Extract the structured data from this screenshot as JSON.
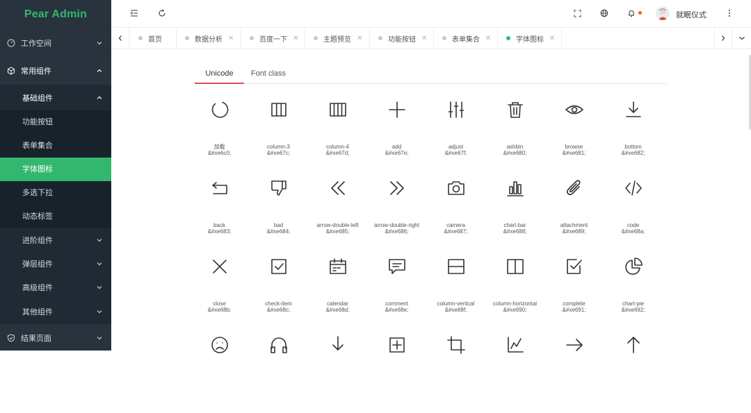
{
  "app": {
    "logo": "Pear Admin"
  },
  "sidebar": {
    "workspace": "工作空间",
    "common": "常用组件",
    "basic": "基础组件",
    "leaves": [
      {
        "label": "功能按钮",
        "active": false
      },
      {
        "label": "表单集合",
        "active": false
      },
      {
        "label": "字体图标",
        "active": true
      },
      {
        "label": "多选下拉",
        "active": false
      },
      {
        "label": "动态标签",
        "active": false
      }
    ],
    "advanced": "进阶组件",
    "popup": "弹层组件",
    "senior": "高级组件",
    "other": "其他组件",
    "result": "结果页面"
  },
  "header": {
    "username": "就眠仪式"
  },
  "tabs": [
    {
      "label": "首页",
      "closable": false,
      "active": false
    },
    {
      "label": "数据分析",
      "closable": true,
      "active": false
    },
    {
      "label": "百度一下",
      "closable": true,
      "active": false
    },
    {
      "label": "主题预览",
      "closable": true,
      "active": false
    },
    {
      "label": "功能按钮",
      "closable": true,
      "active": false
    },
    {
      "label": "表单集合",
      "closable": true,
      "active": false
    },
    {
      "label": "字体图标",
      "closable": true,
      "active": true
    }
  ],
  "page_tabs": {
    "unicode": "Unicode",
    "fontclass": "Font class"
  },
  "icons": [
    {
      "name": "加载",
      "code": "&#xe6c0;",
      "icon": "loading-icon"
    },
    {
      "name": "column-3",
      "code": "&#xe67c;",
      "icon": "column-3-icon"
    },
    {
      "name": "column-4",
      "code": "&#xe67d;",
      "icon": "column-4-icon"
    },
    {
      "name": "add",
      "code": "&#xe67e;",
      "icon": "add-icon"
    },
    {
      "name": "adjust",
      "code": "&#xe67f;",
      "icon": "adjust-icon"
    },
    {
      "name": "ashbin",
      "code": "&#xe680;",
      "icon": "ashbin-icon"
    },
    {
      "name": "browse",
      "code": "&#xe681;",
      "icon": "browse-icon"
    },
    {
      "name": "bottom",
      "code": "&#xe682;",
      "icon": "bottom-icon"
    },
    {
      "name": "back",
      "code": "&#xe683;",
      "icon": "back-icon"
    },
    {
      "name": "bad",
      "code": "&#xe684;",
      "icon": "bad-icon"
    },
    {
      "name": "arrow-double-left",
      "code": "&#xe685;",
      "icon": "arrow-double-left-icon"
    },
    {
      "name": "arrow-double-right",
      "code": "&#xe686;",
      "icon": "arrow-double-right-icon"
    },
    {
      "name": "camera",
      "code": "&#xe687;",
      "icon": "camera-icon"
    },
    {
      "name": "chart-bar",
      "code": "&#xe688;",
      "icon": "chart-bar-icon"
    },
    {
      "name": "attachment",
      "code": "&#xe689;",
      "icon": "attachment-icon"
    },
    {
      "name": "code",
      "code": "&#xe68a;",
      "icon": "code-icon"
    },
    {
      "name": "close",
      "code": "&#xe68b;",
      "icon": "close-icon"
    },
    {
      "name": "check-item",
      "code": "&#xe68c;",
      "icon": "check-item-icon"
    },
    {
      "name": "calendar",
      "code": "&#xe68d;",
      "icon": "calendar-icon"
    },
    {
      "name": "comment",
      "code": "&#xe68e;",
      "icon": "comment-icon"
    },
    {
      "name": "column-vertical",
      "code": "&#xe68f;",
      "icon": "column-vertical-icon"
    },
    {
      "name": "column-horizontal",
      "code": "&#xe690;",
      "icon": "column-horizontal-icon"
    },
    {
      "name": "complete",
      "code": "&#xe691;",
      "icon": "complete-icon"
    },
    {
      "name": "chart-pie",
      "code": "&#xe692;",
      "icon": "chart-pie-icon"
    },
    {
      "name": "",
      "code": "",
      "icon": "sad-face-icon"
    },
    {
      "name": "",
      "code": "",
      "icon": "headphones-icon"
    },
    {
      "name": "",
      "code": "",
      "icon": "download-icon"
    },
    {
      "name": "",
      "code": "",
      "icon": "add-image-icon"
    },
    {
      "name": "",
      "code": "",
      "icon": "crop-icon"
    },
    {
      "name": "",
      "code": "",
      "icon": "chart-line-icon"
    },
    {
      "name": "",
      "code": "",
      "icon": "arrow-right-icon"
    },
    {
      "name": "",
      "code": "",
      "icon": "arrow-up-icon"
    }
  ],
  "colors": {
    "brand": "#33b76f",
    "sidebar_bg": "#28333e",
    "tab_underline": "#e24e4e",
    "notify_dot": "#ff5722"
  }
}
